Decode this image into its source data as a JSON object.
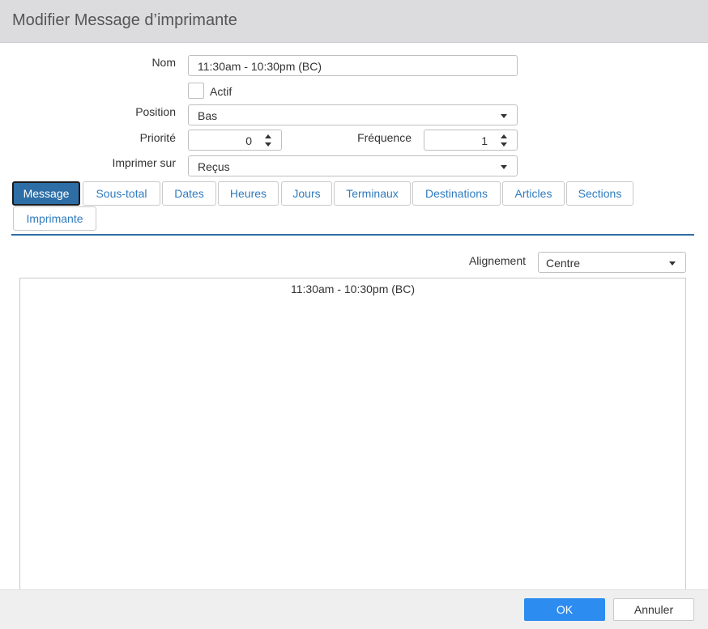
{
  "dialog": {
    "title": "Modifier Message d’imprimante"
  },
  "form": {
    "name_label": "Nom",
    "name_value": "11:30am - 10:30pm (BC)",
    "active_label": "Actif",
    "position_label": "Position",
    "position_value": "Bas",
    "priority_label": "Priorité",
    "priority_value": "0",
    "frequency_label": "Fréquence",
    "frequency_value": "1",
    "print_on_label": "Imprimer sur",
    "print_on_value": "Reçus"
  },
  "tabs": [
    {
      "label": "Message"
    },
    {
      "label": "Sous-total"
    },
    {
      "label": "Dates"
    },
    {
      "label": "Heures"
    },
    {
      "label": "Jours"
    },
    {
      "label": "Terminaux"
    },
    {
      "label": "Destinations"
    },
    {
      "label": "Articles"
    },
    {
      "label": "Sections"
    },
    {
      "label": "Imprimante"
    }
  ],
  "message_panel": {
    "alignment_label": "Alignement",
    "alignment_value": "Centre",
    "message_text": "11:30am - 10:30pm (BC)"
  },
  "footer": {
    "ok_label": "OK",
    "cancel_label": "Annuler"
  },
  "colors": {
    "accent": "#2e6ea6",
    "ok_button": "#2d8cf0",
    "tab_text": "#2f7bc0"
  }
}
